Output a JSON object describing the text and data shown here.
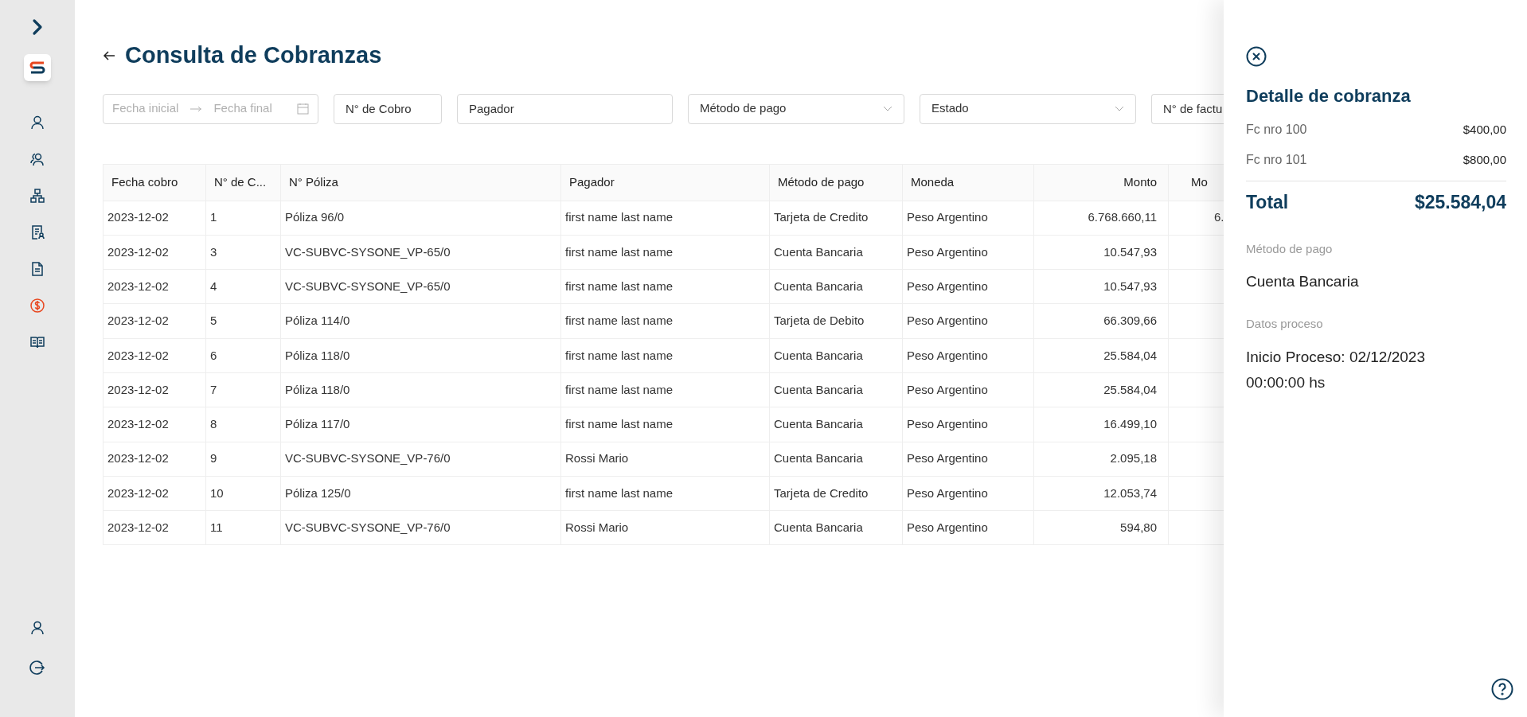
{
  "sidebar": {
    "items": [
      {
        "selected": false
      },
      {
        "selected": false
      },
      {
        "selected": false
      },
      {
        "selected": false
      },
      {
        "selected": false
      },
      {
        "selected": true
      },
      {
        "selected": false
      }
    ]
  },
  "page": {
    "title": "Consulta de Cobranzas"
  },
  "filters": {
    "date_range": {
      "start_placeholder": "Fecha inicial",
      "end_placeholder": "Fecha final"
    },
    "fields": [
      {
        "kind": "text",
        "placeholder": "N° de Cobro"
      },
      {
        "kind": "text",
        "placeholder": "Pagador"
      },
      {
        "kind": "select",
        "placeholder": "Método de pago"
      },
      {
        "kind": "select",
        "placeholder": "Estado"
      },
      {
        "kind": "text",
        "placeholder": "N° de factu"
      }
    ]
  },
  "table": {
    "columns": [
      "Fecha cobro",
      "N° de C...",
      "N° Póliza",
      "Pagador",
      "Método de pago",
      "Moneda",
      "Monto",
      "Mo"
    ],
    "rows": [
      {
        "cells": [
          "2023-12-02",
          "1",
          "Póliza 96/0",
          "first name last name",
          "Tarjeta de Credito",
          "Peso Argentino",
          "6.768.660,11",
          "6."
        ]
      },
      {
        "cells": [
          "2023-12-02",
          "3",
          "VC-SUBVC-SYSONE_VP-65/0",
          "first name last name",
          "Cuenta Bancaria",
          "Peso Argentino",
          "10.547,93"
        ]
      },
      {
        "cells": [
          "2023-12-02",
          "4",
          "VC-SUBVC-SYSONE_VP-65/0",
          "first name last name",
          "Cuenta Bancaria",
          "Peso Argentino",
          "10.547,93"
        ]
      },
      {
        "cells": [
          "2023-12-02",
          "5",
          "Póliza 114/0",
          "first name last name",
          "Tarjeta de Debito",
          "Peso Argentino",
          "66.309,66"
        ]
      },
      {
        "cells": [
          "2023-12-02",
          "6",
          "Póliza 118/0",
          "first name last name",
          "Cuenta Bancaria",
          "Peso Argentino",
          "25.584,04"
        ]
      },
      {
        "cells": [
          "2023-12-02",
          "7",
          "Póliza 118/0",
          "first name last name",
          "Cuenta Bancaria",
          "Peso Argentino",
          "25.584,04"
        ]
      },
      {
        "cells": [
          "2023-12-02",
          "8",
          "Póliza 117/0",
          "first name last name",
          "Cuenta Bancaria",
          "Peso Argentino",
          "16.499,10"
        ]
      },
      {
        "cells": [
          "2023-12-02",
          "9",
          "VC-SUBVC-SYSONE_VP-76/0",
          "Rossi Mario",
          "Cuenta Bancaria",
          "Peso Argentino",
          "2.095,18"
        ]
      },
      {
        "cells": [
          "2023-12-02",
          "10",
          "Póliza 125/0",
          "first name last name",
          "Tarjeta de Credito",
          "Peso Argentino",
          "12.053,74"
        ]
      },
      {
        "cells": [
          "2023-12-02",
          "11",
          "VC-SUBVC-SYSONE_VP-76/0",
          "Rossi Mario",
          "Cuenta Bancaria",
          "Peso Argentino",
          "594,80"
        ]
      }
    ]
  },
  "detail_panel": {
    "title": "Detalle de cobranza",
    "items": [
      {
        "label": "Fc nro 100",
        "amount": "$400,00"
      },
      {
        "label": "Fc nro 101",
        "amount": "$800,00"
      }
    ],
    "total": {
      "label": "Total",
      "amount": "$25.584,04"
    },
    "sections": [
      {
        "label": "Método de pago",
        "value": "Cuenta Bancaria"
      },
      {
        "label": "Datos proceso",
        "value": "Inicio Proceso: 02/12/2023 00:00:00 hs"
      }
    ]
  }
}
